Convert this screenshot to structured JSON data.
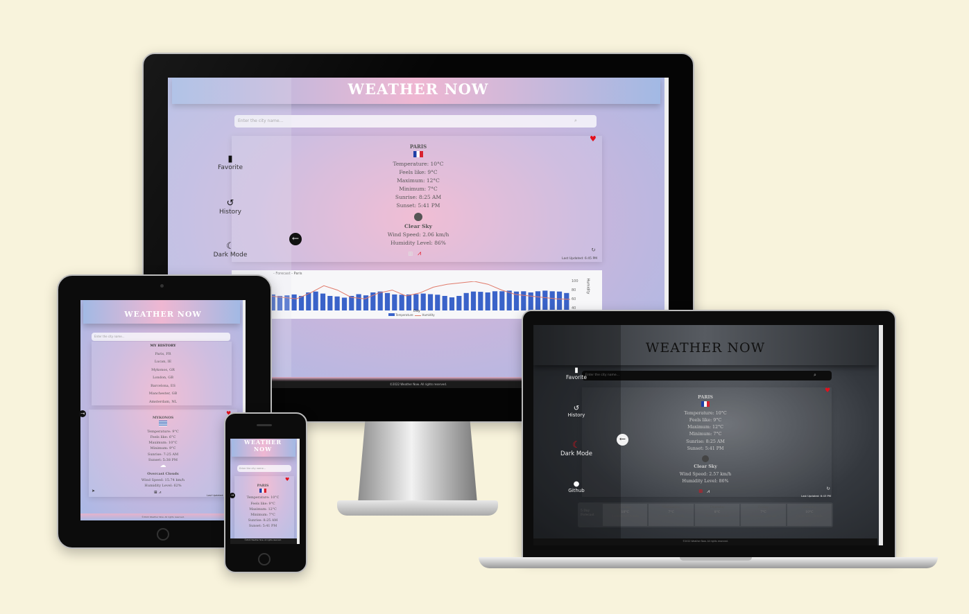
{
  "app": {
    "title": "WEATHER NOW",
    "search_placeholder": "Enter the city name...",
    "footer": "©2022 Weather Now. All rights reserved."
  },
  "nav": {
    "favorite": "Favorite",
    "history": "History",
    "dark_mode": "Dark Mode",
    "github": "Github"
  },
  "current": {
    "city": "PARIS",
    "temperature": "Temperature: 10°C",
    "feels_like": "Feels like: 9°C",
    "maximum": "Maximum: 12°C",
    "minimum": "Minimum: 7°C",
    "sunrise": "Sunrise: 8:25 AM",
    "sunset": "Sunset: 5:41 PM",
    "description": "Clear Sky",
    "wind": "Wind Speed: 2.06 km/h",
    "wind_dark": "Wind Speed: 2.57 km/h",
    "humidity": "Humidity Level: 86%",
    "last_updated": "Last Updated: 6:45 PM",
    "last_updated_dark": "Last Updated: 6:43 PM"
  },
  "chart": {
    "title_fragment": "- Forecast - Paris",
    "xlabel": "Day",
    "legend_temperature": "Temperature",
    "legend_humidity": "Humidity",
    "y_right_label": "Humidity",
    "y_ticks": [
      "100",
      "80",
      "60",
      "40"
    ],
    "bar_heights": [
      0.55,
      0.5,
      0.52,
      0.55,
      0.5,
      0.62,
      0.65,
      0.58,
      0.5,
      0.48,
      0.44,
      0.5,
      0.56,
      0.52,
      0.62,
      0.65,
      0.6,
      0.55,
      0.54,
      0.55,
      0.56,
      0.58,
      0.56,
      0.54,
      0.5,
      0.45,
      0.5,
      0.6,
      0.65,
      0.64,
      0.62,
      0.66,
      0.66,
      0.68,
      0.65,
      0.66,
      0.62,
      0.66,
      0.68,
      0.66,
      0.65,
      0.6
    ]
  },
  "history": {
    "heading": "MY HISTORY",
    "items": [
      "Paris, FR",
      "Lucan, IE",
      "Mykonos, GR",
      "London, GB",
      "Barcelona, ES",
      "Manchester, GB",
      "Amsterdam, NL"
    ]
  },
  "tablet_city": {
    "city": "MYKONOS",
    "temperature": "Temperature: 9°C",
    "feels_like": "Feels like: 6°C",
    "maximum": "Maximum: 10°C",
    "minimum": "Minimum: 9°C",
    "sunrise": "Sunrise: 7:25 AM",
    "sunset": "Sunset: 5:38 PM",
    "description": "Overcast Clouds",
    "wind": "Wind Speed: 15.74 km/h",
    "humidity": "Humidity Level: 62%",
    "last_updated": "Last Updated: 7:"
  },
  "phone_city": {
    "title_line1": "WEATHER",
    "title_line2": "NOW",
    "city": "PARIS",
    "temperature": "Temperature: 10°C",
    "feels_like": "Feels like: 9°C",
    "maximum": "Maximum: 12°C",
    "minimum": "Minimum: 7°C",
    "sunrise": "Sunrise: 8:25 AM",
    "sunset": "Sunset: 5:41 PM"
  },
  "forecast": {
    "label": "5 Day Forecast",
    "days": [
      {
        "day": "Tuesday",
        "temp": "10°C",
        "desc": "Scattered Clouds"
      },
      {
        "day": "Wednesday",
        "temp": "7°C",
        "desc": "Overcast Clouds"
      },
      {
        "day": "Thursday",
        "temp": "8°C",
        "desc": "Broken Clouds"
      },
      {
        "day": "Friday",
        "temp": "7°C",
        "desc": "Overcast Clouds"
      },
      {
        "day": "Saturday",
        "temp": "10°C",
        "desc": "Overcast Clouds"
      }
    ]
  },
  "colors": {
    "background": "#f8f3dc",
    "heart": "#e3101c",
    "bar": "#3a63c9",
    "line": "#e07a6a"
  }
}
